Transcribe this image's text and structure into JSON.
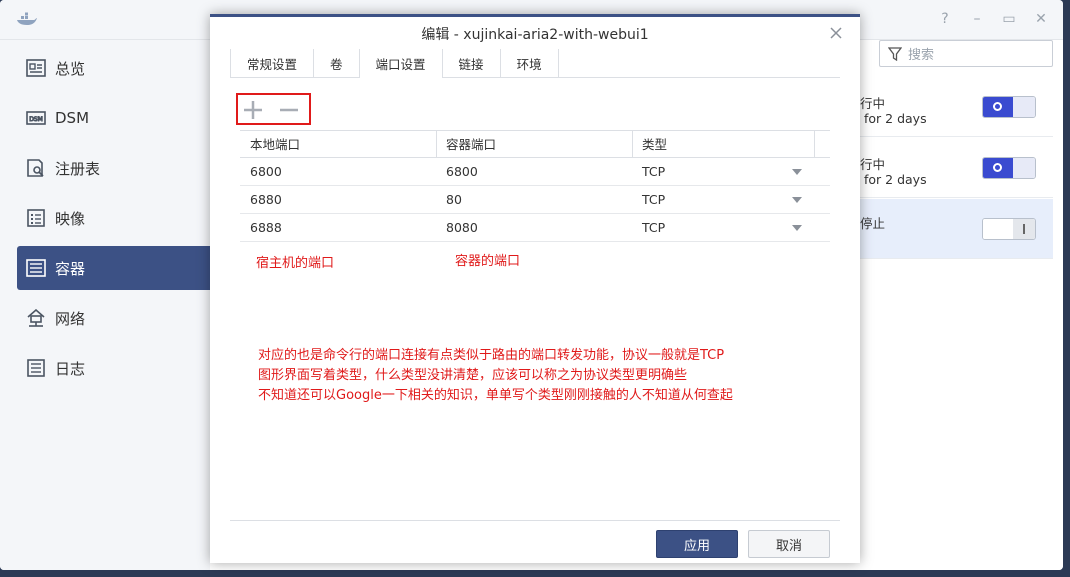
{
  "sidebar": {
    "items": [
      {
        "label": "总览",
        "icon": "overview-icon"
      },
      {
        "label": "DSM",
        "icon": "dsm-icon"
      },
      {
        "label": "注册表",
        "icon": "registry-icon"
      },
      {
        "label": "映像",
        "icon": "image-icon"
      },
      {
        "label": "容器",
        "icon": "container-icon",
        "active": true
      },
      {
        "label": "网络",
        "icon": "network-icon"
      },
      {
        "label": "日志",
        "icon": "log-icon"
      }
    ]
  },
  "search": {
    "placeholder": "搜索"
  },
  "container_list": [
    {
      "status": "行中",
      "uptime": "for 2 days",
      "toggle": "on"
    },
    {
      "status": "行中",
      "uptime": "for 2 days",
      "toggle": "on"
    },
    {
      "status": "停止",
      "uptime": "",
      "toggle": "off"
    }
  ],
  "dialog": {
    "title": "编辑 - xujinkai-aria2-with-webui1",
    "tabs": [
      "常规设置",
      "卷",
      "端口设置",
      "链接",
      "环境"
    ],
    "active_tab": "端口设置",
    "columns": [
      "本地端口",
      "容器端口",
      "类型"
    ],
    "rows": [
      {
        "local": "6800",
        "container": "6800",
        "type": "TCP"
      },
      {
        "local": "6880",
        "container": "80",
        "type": "TCP"
      },
      {
        "local": "6888",
        "container": "8080",
        "type": "TCP"
      }
    ],
    "apply_label": "应用",
    "cancel_label": "取消"
  },
  "annotations": {
    "host_port": "宿主机的端口",
    "container_port": "容器的端口",
    "note_line1": "对应的也是命令行的端口连接有点类似于路由的端口转发功能，协议一般就是TCP",
    "note_line2": "图形界面写着类型，什么类型没讲清楚，应该可以称之为协议类型更明确些",
    "note_line3": "不知道还可以Google一下相关的知识，单单写个类型刚刚接触的人不知道从何查起"
  },
  "colors": {
    "accent": "#3c5185",
    "annotation": "#e01a1a",
    "toggle_on": "#3a4bd0"
  }
}
